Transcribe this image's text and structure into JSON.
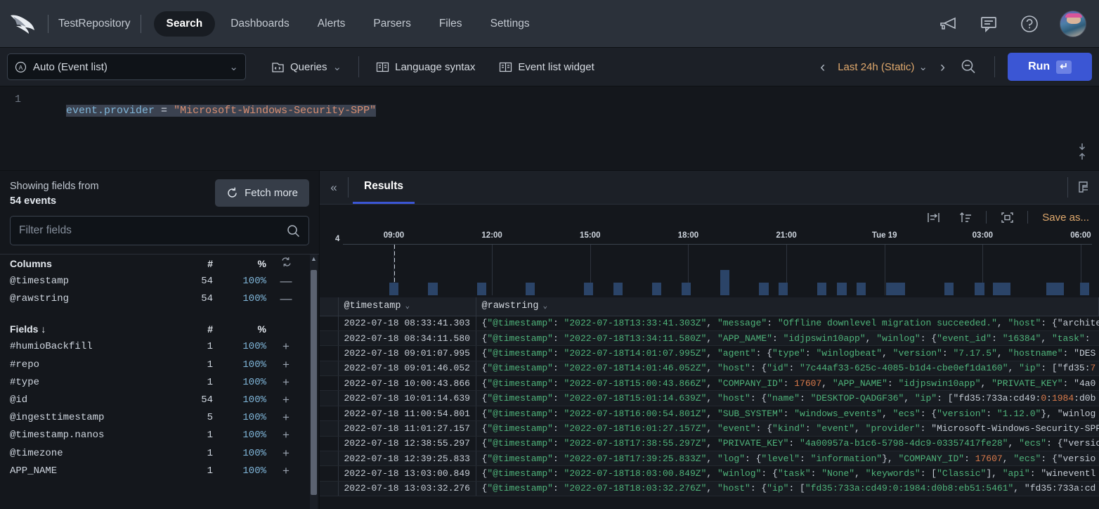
{
  "topnav": {
    "logo_icon": "falcon-logo-icon",
    "repository": "TestRepository",
    "items": [
      {
        "label": "Search",
        "active": true
      },
      {
        "label": "Dashboards",
        "active": false
      },
      {
        "label": "Alerts",
        "active": false
      },
      {
        "label": "Parsers",
        "active": false
      },
      {
        "label": "Files",
        "active": false
      },
      {
        "label": "Settings",
        "active": false
      }
    ],
    "icons": [
      "megaphone-icon",
      "feedback-icon",
      "help-circle-icon",
      "avatar"
    ]
  },
  "toolbar": {
    "viz_select": "Auto (Event list)",
    "viz_prefix_icon": "auto-circle-a-icon",
    "queries_label": "Queries",
    "language_syntax_label": "Language syntax",
    "event_list_widget_label": "Event list widget",
    "prev_label": "‹",
    "next_label": "›",
    "timerange": "Last 24h (Static)",
    "zoom_out_icon": "zoom-out-icon",
    "run_label": "Run",
    "run_kbd": "↵"
  },
  "editor": {
    "line_number": "1",
    "query_field": "event.provider",
    "query_operator": " = ",
    "query_value": "\"Microsoft-Windows-Security-SPP\"",
    "download_icon": "collapse-vertical-icon"
  },
  "fields_panel": {
    "showing_label": "Showing fields from",
    "showing_count": "54 events",
    "fetch_more_label": "Fetch more",
    "fetch_more_icon": "refresh-icon",
    "filter_placeholder": "Filter fields",
    "filter_value": "",
    "search_icon": "search-icon",
    "columns_header": {
      "name": "Columns",
      "num": "#",
      "pct": "%",
      "action": "sync-icon"
    },
    "columns": [
      {
        "name": "@timestamp",
        "num": "54",
        "pct": "100%",
        "action": "—"
      },
      {
        "name": "@rawstring",
        "num": "54",
        "pct": "100%",
        "action": "—"
      }
    ],
    "fields_header": {
      "name": "Fields ↓",
      "num": "#",
      "pct": "%"
    },
    "fields": [
      {
        "name": "#humioBackfill",
        "num": "1",
        "pct": "100%",
        "action": "+"
      },
      {
        "name": "#repo",
        "num": "1",
        "pct": "100%",
        "action": "+"
      },
      {
        "name": "#type",
        "num": "1",
        "pct": "100%",
        "action": "+"
      },
      {
        "name": "@id",
        "num": "54",
        "pct": "100%",
        "action": "+"
      },
      {
        "name": "@ingesttimestamp",
        "num": "5",
        "pct": "100%",
        "action": "+"
      },
      {
        "name": "@timestamp.nanos",
        "num": "1",
        "pct": "100%",
        "action": "+"
      },
      {
        "name": "@timezone",
        "num": "1",
        "pct": "100%",
        "action": "+"
      },
      {
        "name": "APP_NAME",
        "num": "1",
        "pct": "100%",
        "action": "+"
      }
    ]
  },
  "results": {
    "collapse_icon": "collapse-left-icon",
    "tab_label": "Results",
    "widget_icon": "widget-icon",
    "chart_toolbar": {
      "icons": [
        "align-bars-icon",
        "sort-icon",
        "fullscreen-icon"
      ],
      "save_as_label": "Save as..."
    },
    "table": {
      "columns": [
        "@timestamp",
        "@rawstring"
      ],
      "rows": [
        {
          "timestamp": "2022-07-18 08:33:41.303",
          "raw": "{\"@timestamp\": \"2022-07-18T13:33:41.303Z\", \"message\": \"Offline downlevel migration succeeded.\", \"host\": {\"archite"
        },
        {
          "timestamp": "2022-07-18 08:34:11.580",
          "raw": "{\"@timestamp\": \"2022-07-18T13:34:11.580Z\", \"APP_NAME\": \"idjpswin10app\", \"winlog\": {\"event_id\": \"16384\", \"task\":"
        },
        {
          "timestamp": "2022-07-18 09:01:07.995",
          "raw": "{\"@timestamp\": \"2022-07-18T14:01:07.995Z\", \"agent\": {\"type\": \"winlogbeat\", \"version\": \"7.17.5\", \"hostname\": \"DES"
        },
        {
          "timestamp": "2022-07-18 09:01:46.052",
          "raw": "{\"@timestamp\": \"2022-07-18T14:01:46.052Z\", \"host\": {\"id\": \"7c44af33-625c-4085-b1d4-cbe0ef1da160\", \"ip\": [\"fd35:7"
        },
        {
          "timestamp": "2022-07-18 10:00:43.866",
          "raw": "{\"@timestamp\": \"2022-07-18T15:00:43.866Z\", \"COMPANY_ID\": 17607, \"APP_NAME\": \"idjpswin10app\", \"PRIVATE_KEY\": \"4a0"
        },
        {
          "timestamp": "2022-07-18 10:01:14.639",
          "raw": "{\"@timestamp\": \"2022-07-18T15:01:14.639Z\", \"host\": {\"name\": \"DESKTOP-QADGF36\", \"ip\": [\"fd35:733a:cd49:0:1984:d0b"
        },
        {
          "timestamp": "2022-07-18 11:00:54.801",
          "raw": "{\"@timestamp\": \"2022-07-18T16:00:54.801Z\", \"SUB_SYSTEM\": \"windows_events\", \"ecs\": {\"version\": \"1.12.0\"}, \"winlog"
        },
        {
          "timestamp": "2022-07-18 11:01:27.157",
          "raw": "{\"@timestamp\": \"2022-07-18T16:01:27.157Z\", \"event\": {\"kind\": \"event\", \"provider\": \"Microsoft-Windows-Security-SPP"
        },
        {
          "timestamp": "2022-07-18 12:38:55.297",
          "raw": "{\"@timestamp\": \"2022-07-18T17:38:55.297Z\", \"PRIVATE_KEY\": \"4a00957a-b1c6-5798-4dc9-03357417fe28\", \"ecs\": {\"versio"
        },
        {
          "timestamp": "2022-07-18 12:39:25.833",
          "raw": "{\"@timestamp\": \"2022-07-18T17:39:25.833Z\", \"log\": {\"level\": \"information\"}, \"COMPANY_ID\": 17607, \"ecs\": {\"versio"
        },
        {
          "timestamp": "2022-07-18 13:03:00.849",
          "raw": "{\"@timestamp\": \"2022-07-18T18:03:00.849Z\", \"winlog\": {\"task\": \"None\", \"keywords\": [\"Classic\"], \"api\": \"wineventl"
        },
        {
          "timestamp": "2022-07-18 13:03:32.276",
          "raw": "{\"@timestamp\": \"2022-07-18T18:03:32.276Z\", \"host\": {\"ip\": [\"fd35:733a:cd49:0:1984:d0b8:eb51:5461\", \"fd35:733a:cd"
        }
      ]
    }
  },
  "chart_data": {
    "type": "bar",
    "title": "",
    "xlabel": "",
    "ylabel": "",
    "ylim": [
      0,
      4
    ],
    "ymax_tick": "4",
    "grid": true,
    "legend": null,
    "tick_labels": [
      "09:00",
      "12:00",
      "15:00",
      "18:00",
      "21:00",
      "Tue 19",
      "03:00",
      "06:00"
    ],
    "tick_positions_pct": [
      6.8,
      19.9,
      33.0,
      46.1,
      59.2,
      72.3,
      85.4,
      98.5
    ],
    "gridline_positions_pct": [
      6.8,
      19.9,
      33.0,
      46.1,
      59.2,
      72.3,
      85.4,
      98.5
    ],
    "cursor_line_pct": 6.8,
    "bar_width_pct": 1.25,
    "bars": [
      {
        "x_pct": 6.8,
        "value": 1
      },
      {
        "x_pct": 12.0,
        "value": 1
      },
      {
        "x_pct": 18.5,
        "value": 1
      },
      {
        "x_pct": 25.0,
        "value": 1
      },
      {
        "x_pct": 32.8,
        "value": 1
      },
      {
        "x_pct": 36.7,
        "value": 1
      },
      {
        "x_pct": 41.9,
        "value": 1
      },
      {
        "x_pct": 45.8,
        "value": 1
      },
      {
        "x_pct": 51.0,
        "value": 2
      },
      {
        "x_pct": 56.2,
        "value": 1
      },
      {
        "x_pct": 58.8,
        "value": 1
      },
      {
        "x_pct": 63.9,
        "value": 1
      },
      {
        "x_pct": 66.6,
        "value": 1
      },
      {
        "x_pct": 69.2,
        "value": 1
      },
      {
        "x_pct": 73.1,
        "value": 1
      },
      {
        "x_pct": 74.4,
        "value": 1
      },
      {
        "x_pct": 80.9,
        "value": 1
      },
      {
        "x_pct": 85.0,
        "value": 1
      },
      {
        "x_pct": 87.4,
        "value": 1
      },
      {
        "x_pct": 88.5,
        "value": 1
      },
      {
        "x_pct": 94.5,
        "value": 1
      },
      {
        "x_pct": 95.6,
        "value": 1
      },
      {
        "x_pct": 99.0,
        "value": 1
      }
    ]
  }
}
